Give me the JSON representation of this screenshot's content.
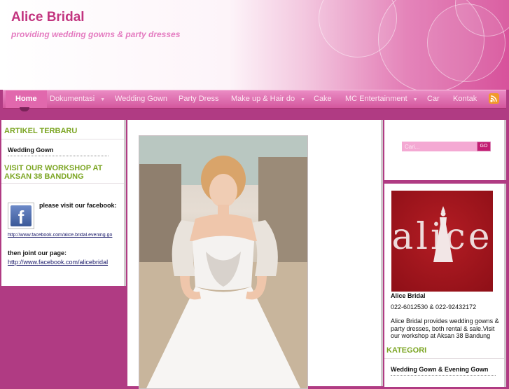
{
  "site": {
    "title": "Alice Bridal",
    "tagline": "providing wedding gowns & party dresses"
  },
  "colors": {
    "brand_pink": "#c2347f",
    "nav_pink": "#e168ad",
    "widget_green": "#7ba522",
    "logo_red": "#a3161f"
  },
  "nav": {
    "items": [
      {
        "label": "Home",
        "active": true
      },
      {
        "label": "Dokumentasi",
        "has_dropdown": true
      },
      {
        "label": "Wedding Gown"
      },
      {
        "label": "Party Dress"
      },
      {
        "label": "Make up & Hair do",
        "has_dropdown": true
      },
      {
        "label": "Cake"
      },
      {
        "label": "MC Entertainment",
        "has_dropdown": true
      },
      {
        "label": "Car"
      },
      {
        "label": "Kontak"
      }
    ],
    "arrow": "▼",
    "rss_icon": "rss-icon"
  },
  "left_sidebar": {
    "recent_title": "ARTIKEL TERBARU",
    "recent_items": [
      "Wedding Gown"
    ],
    "workshop_title": "VISIT OUR WORKSHOP AT AKSAN 38 BANDUNG",
    "facebook_text": "please visit our facebook:",
    "facebook_link": "http://www.facebook.com/alice.bridal.evening.go",
    "page_text": "then joint our page:",
    "page_link": "http://www.facebook.com/alicebridal"
  },
  "center": {
    "photo_icon": "bride-photo"
  },
  "right_sidebar": {
    "search_placeholder": "Cari...",
    "search_button": "GO",
    "logo_text": "alice",
    "profile_name": "Alice Bridal",
    "profile_phone": "022-6012530 & 022-92432172",
    "profile_desc": "Alice Bridal provides wedding gowns & party dresses, both rental & sale.Visit our workshop at Aksan 38 Bandung",
    "category_title": "KATEGORI",
    "category_items": [
      "Wedding Gown & Evening Gown"
    ]
  }
}
